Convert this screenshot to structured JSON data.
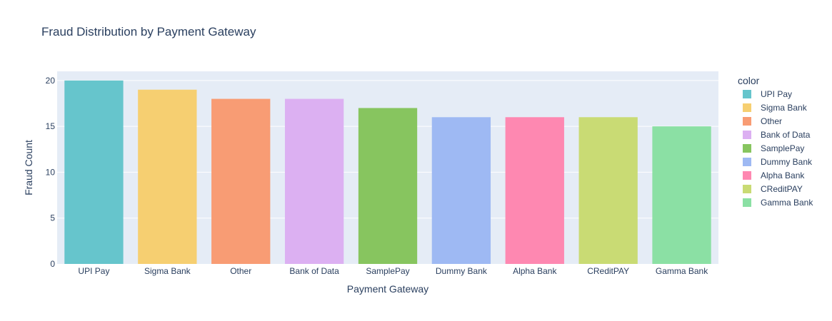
{
  "chart_data": {
    "type": "bar",
    "title": "Fraud Distribution by Payment Gateway",
    "xlabel": "Payment Gateway",
    "ylabel": "Fraud Count",
    "categories": [
      "UPI Pay",
      "Sigma Bank",
      "Other",
      "Bank of Data",
      "SamplePay",
      "Dummy Bank",
      "Alpha Bank",
      "CReditPAY",
      "Gamma Bank"
    ],
    "values": [
      20,
      19,
      18,
      18,
      17,
      16,
      16,
      16,
      15
    ],
    "colors": [
      "#66c5cc",
      "#f6cf71",
      "#f89c74",
      "#dcb0f2",
      "#87c55f",
      "#9eb9f3",
      "#fe88b1",
      "#c9db74",
      "#8be0a4"
    ],
    "ylim": [
      0,
      21
    ],
    "yticks": [
      0,
      5,
      10,
      15,
      20
    ],
    "grid": true,
    "legend": {
      "title": "color",
      "placement": "right",
      "entries": [
        "UPI Pay",
        "Sigma Bank",
        "Other",
        "Bank of Data",
        "SamplePay",
        "Dummy Bank",
        "Alpha Bank",
        "CReditPAY",
        "Gamma Bank"
      ]
    },
    "background": "#e5ecf6",
    "gridline_color": "#ffffff",
    "text_color": "#2a3f5f"
  }
}
